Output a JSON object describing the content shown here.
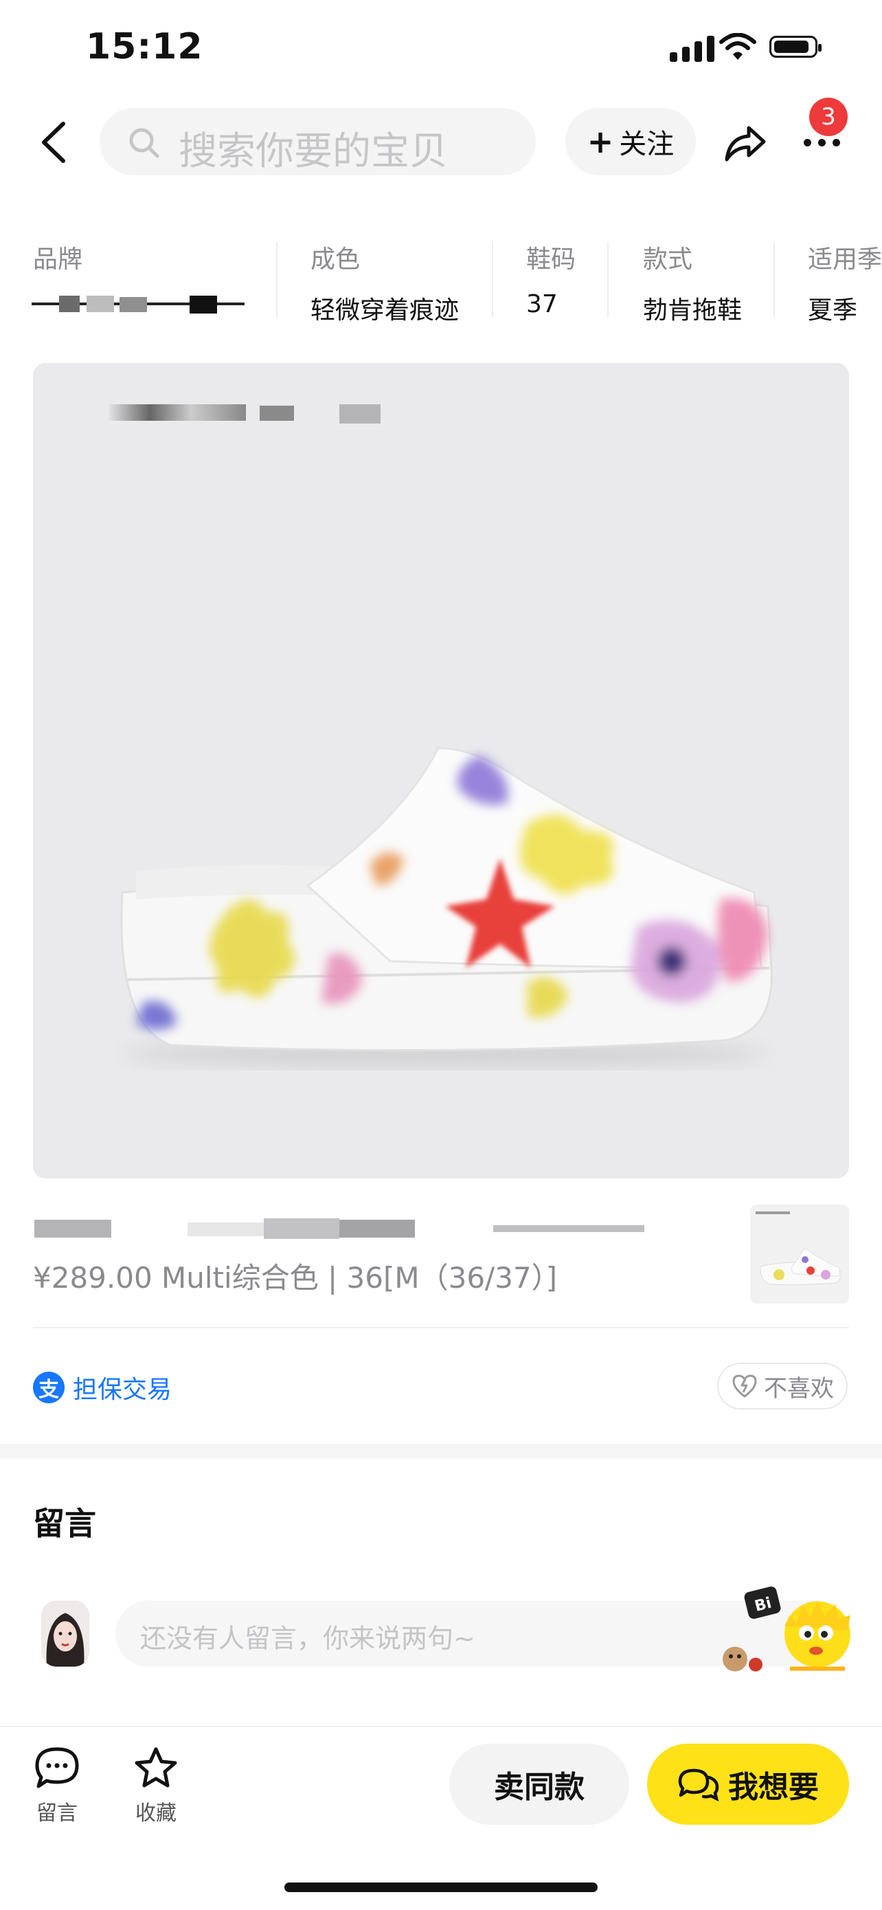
{
  "status_bar": {
    "time": "15:12"
  },
  "nav": {
    "search_placeholder": "搜索你要的宝贝",
    "follow_label": "关注",
    "notification_count": "3"
  },
  "attributes": [
    {
      "label": "品牌",
      "value": ""
    },
    {
      "label": "成色",
      "value": "轻微穿着痕迹"
    },
    {
      "label": "鞋码",
      "value": "37"
    },
    {
      "label": "款式",
      "value": "勃肯拖鞋"
    },
    {
      "label": "适用季",
      "value": "夏季"
    }
  ],
  "listing": {
    "price_line": "¥289.00 Multi综合色 | 36[M（36/37）]"
  },
  "trade": {
    "guarantee_label": "担保交易",
    "alipay_glyph": "支",
    "dislike_label": "不喜欢"
  },
  "comments": {
    "title": "留言",
    "input_placeholder": "还没有人留言，你来说两句~"
  },
  "bottom_bar": {
    "comment_label": "留言",
    "favorite_label": "收藏",
    "sell_same_label": "卖同款",
    "want_label": "我想要"
  },
  "colors": {
    "accent_yellow": "#ffe118",
    "badge_red": "#ee3a3a",
    "alipay_blue": "#1677ff"
  }
}
